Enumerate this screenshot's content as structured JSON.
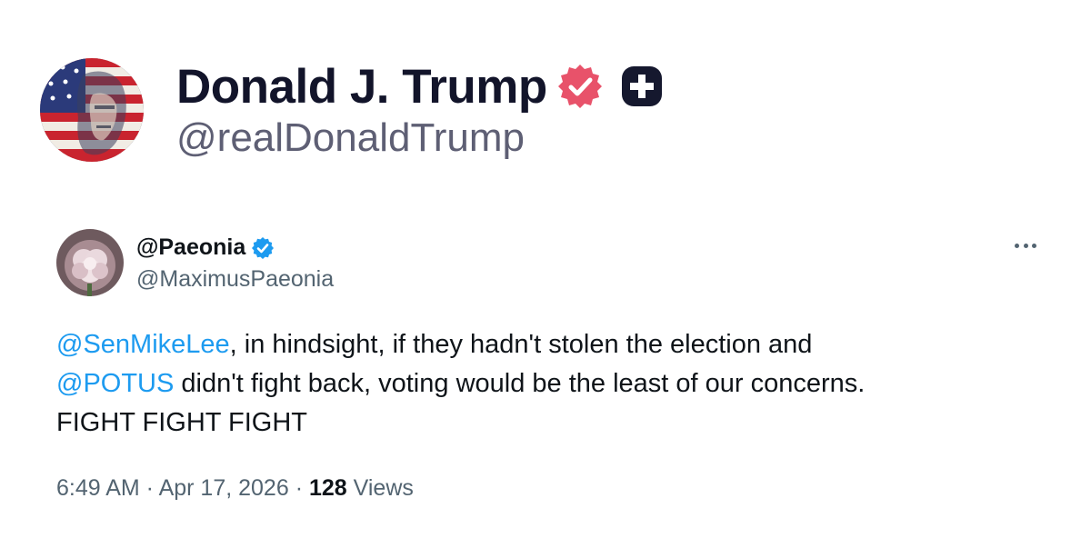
{
  "author": {
    "display_name": "Donald J. Trump",
    "handle": "@realDonaldTrump",
    "verified_badge_icon": "verified-badge-icon",
    "plus_badge_icon": "plus-badge-icon",
    "colors": {
      "name": "#12142a",
      "handle": "#5e5f74",
      "badge": "#e8526a"
    }
  },
  "quoted_tweet": {
    "name": "@Paeonia",
    "handle": "@MaximusPaeonia",
    "mentions": [
      "@SenMikeLee",
      "@POTUS"
    ],
    "body": {
      "line1_mention": "@SenMikeLee",
      "line1_text": ", in hindsight, if they hadn't stolen the election and",
      "line2_mention": "@POTUS",
      "line2_text": " didn't fight back, voting would be the least of our concerns.",
      "line3_text": "FIGHT FIGHT FIGHT"
    },
    "time": "6:49 AM",
    "separator": " · ",
    "date": "Apr 17, 2026",
    "views_count": "128",
    "views_label": " Views",
    "colors": {
      "mention": "#1d9bf0",
      "secondary": "#536471",
      "verified": "#1d9bf0"
    }
  }
}
